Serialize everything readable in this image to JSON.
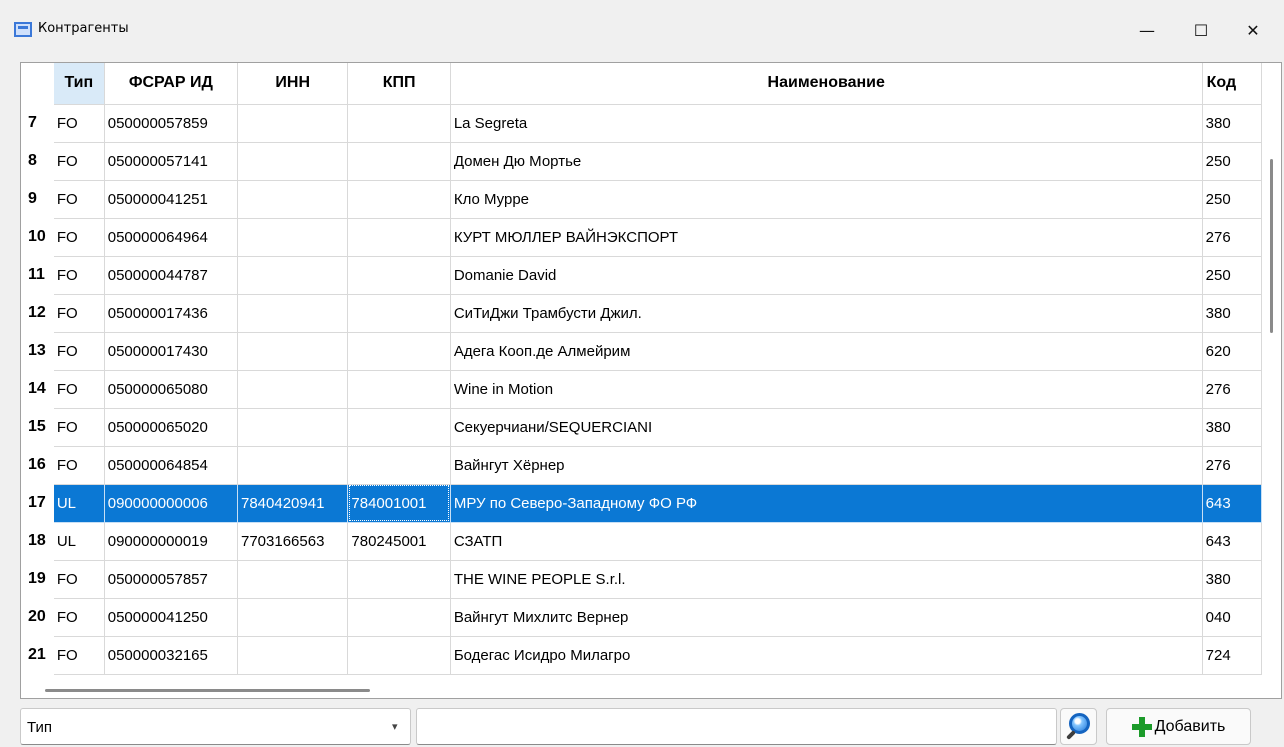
{
  "window": {
    "title": "Контрагенты",
    "minimize": "—",
    "maximize": "☐",
    "close": "✕"
  },
  "table": {
    "columns": [
      "Тип",
      "ФСРАР ИД",
      "ИНН",
      "КПП",
      "Наименование",
      "Код"
    ],
    "rows": [
      {
        "n": "7",
        "type": "FO",
        "fsrar": "050000057859",
        "inn": "",
        "kpp": "",
        "name": "La Segreta",
        "code": "380"
      },
      {
        "n": "8",
        "type": "FO",
        "fsrar": "050000057141",
        "inn": "",
        "kpp": "",
        "name": "Домен Дю Мортье",
        "code": "250"
      },
      {
        "n": "9",
        "type": "FO",
        "fsrar": "050000041251",
        "inn": "",
        "kpp": "",
        "name": "Кло Мурре",
        "code": "250"
      },
      {
        "n": "10",
        "type": "FO",
        "fsrar": "050000064964",
        "inn": "",
        "kpp": "",
        "name": "КУРТ МЮЛЛЕР ВАЙНЭКСПОРТ",
        "code": "276"
      },
      {
        "n": "11",
        "type": "FO",
        "fsrar": "050000044787",
        "inn": "",
        "kpp": "",
        "name": "Domanie David",
        "code": "250"
      },
      {
        "n": "12",
        "type": "FO",
        "fsrar": "050000017436",
        "inn": "",
        "kpp": "",
        "name": "СиТиДжи Трамбусти Джил.",
        "code": "380"
      },
      {
        "n": "13",
        "type": "FO",
        "fsrar": "050000017430",
        "inn": "",
        "kpp": "",
        "name": "Адега Кооп.де Алмейрим",
        "code": "620"
      },
      {
        "n": "14",
        "type": "FO",
        "fsrar": "050000065080",
        "inn": "",
        "kpp": "",
        "name": "Wine in Motion",
        "code": "276"
      },
      {
        "n": "15",
        "type": "FO",
        "fsrar": "050000065020",
        "inn": "",
        "kpp": "",
        "name": "Секуерчиани/SEQUERCIANI",
        "code": "380"
      },
      {
        "n": "16",
        "type": "FO",
        "fsrar": "050000064854",
        "inn": "",
        "kpp": "",
        "name": "Вайнгут Хёрнер",
        "code": "276"
      },
      {
        "n": "17",
        "type": "UL",
        "fsrar": "090000000006",
        "inn": "7840420941",
        "kpp": "784001001",
        "name": "МРУ по Северо-Западному ФО РФ",
        "code": "643"
      },
      {
        "n": "18",
        "type": "UL",
        "fsrar": "090000000019",
        "inn": "7703166563",
        "kpp": "780245001",
        "name": "СЗАТП",
        "code": "643"
      },
      {
        "n": "19",
        "type": "FO",
        "fsrar": "050000057857",
        "inn": "",
        "kpp": "",
        "name": "THE WINE PEOPLE S.r.l.",
        "code": "380"
      },
      {
        "n": "20",
        "type": "FO",
        "fsrar": "050000041250",
        "inn": "",
        "kpp": "",
        "name": "Вайнгут Михлитс Вернер",
        "code": "040"
      },
      {
        "n": "21",
        "type": "FO",
        "fsrar": "050000032165",
        "inn": "",
        "kpp": "",
        "name": "Бодегас Исидро Милагро",
        "code": "724"
      }
    ]
  },
  "filter": {
    "field": "Тип",
    "search_value": "",
    "add_label": "Добавить"
  },
  "colors": {
    "selection": "#0b78d4",
    "header_active": "#d9eaf8",
    "add_icon": "#1c9b2a"
  }
}
